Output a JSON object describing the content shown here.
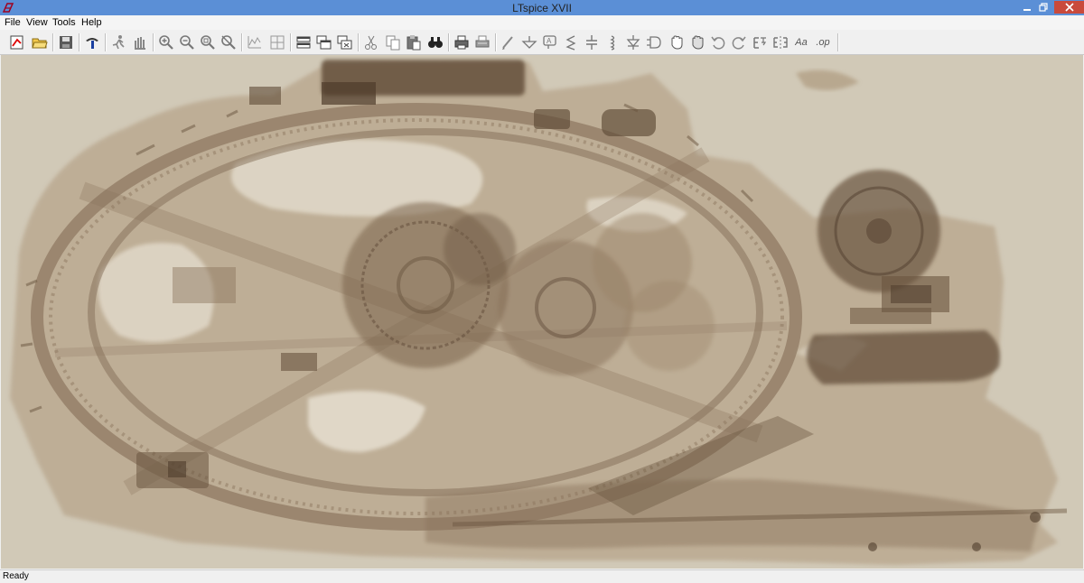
{
  "window": {
    "title": "LTspice XVII",
    "app_icon": "ltspice-logo-icon",
    "controls": [
      "minimize-icon",
      "restore-icon",
      "close-icon"
    ]
  },
  "menu": [
    {
      "label": "File"
    },
    {
      "label": "View"
    },
    {
      "label": "Tools"
    },
    {
      "label": "Help"
    }
  ],
  "toolbar": {
    "buttons": [
      "new-schematic-icon",
      "open-folder-icon",
      "save-icon",
      "control-panel-icon",
      "run-icon",
      "halt-icon",
      "zoom-in-icon",
      "zoom-out-icon",
      "zoom-fit-icon",
      "zoom-cancel-icon",
      "autorange-icon",
      "grid-icon",
      "tile-horizontal-icon",
      "cascade-icon",
      "close-all-icon",
      "cut-icon",
      "copy-icon",
      "paste-icon",
      "find-icon",
      "print-icon",
      "print-preview-icon",
      "wire-icon",
      "ground-icon",
      "label-net-icon",
      "resistor-icon",
      "capacitor-icon",
      "inductor-icon",
      "diode-icon",
      "component-icon",
      "move-icon",
      "drag-icon",
      "undo-icon",
      "redo-icon",
      "rotate-icon",
      "mirror-icon",
      "text-icon",
      "spice-directive-icon"
    ],
    "text_glyphs": {
      "text": "Aa",
      "spice": ".op"
    }
  },
  "canvas": {
    "background_image": "antikythera-mechanism-xray",
    "background_color": "#d1c9b7",
    "ink_color": "#7d6650"
  },
  "status": {
    "text": "Ready"
  }
}
